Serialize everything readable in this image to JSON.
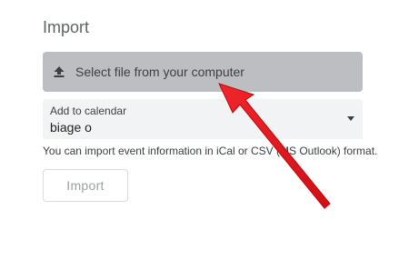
{
  "title": "Import",
  "select_file": {
    "label": "Select file from your computer",
    "icon": "upload-icon"
  },
  "calendar_select": {
    "label": "Add to calendar",
    "value": "biage o",
    "icon": "chevron-down-icon"
  },
  "help_text": "You can import event information in iCal or CSV (MS Outlook) format.",
  "import_button": {
    "label": "Import"
  },
  "annotation": {
    "color": "#e8141b"
  }
}
